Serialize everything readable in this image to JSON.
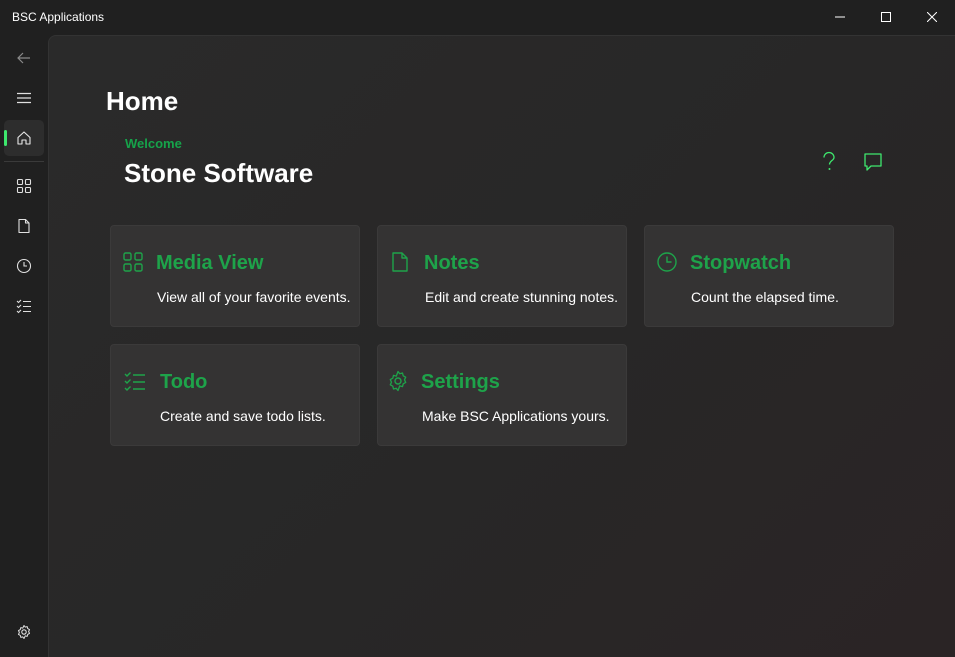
{
  "window": {
    "title": "BSC Applications",
    "controls": [
      "minimize",
      "maximize",
      "close"
    ]
  },
  "nav": {
    "items": [
      {
        "icon": "back-arrow-icon"
      },
      {
        "icon": "hamburger-menu-icon"
      },
      {
        "icon": "home-icon",
        "selected": true
      },
      {
        "icon": "grid-icon"
      },
      {
        "icon": "document-icon"
      },
      {
        "icon": "clock-icon"
      },
      {
        "icon": "checklist-icon"
      },
      {
        "icon": "settings-gear-icon"
      }
    ]
  },
  "page": {
    "title": "Home",
    "welcome": "Welcome",
    "company": "Stone Software"
  },
  "header_actions": [
    {
      "icon": "question-mark-icon"
    },
    {
      "icon": "feedback-chat-icon"
    }
  ],
  "cards": [
    {
      "title": "Media View",
      "description": "View all of your favorite events.",
      "icon": "grid-icon"
    },
    {
      "title": "Notes",
      "description": "Edit and create stunning notes.",
      "icon": "document-icon"
    },
    {
      "title": "Stopwatch",
      "description": "Count the elapsed time.",
      "icon": "clock-icon"
    },
    {
      "title": "Todo",
      "description": "Create and save todo lists.",
      "icon": "checklist-icon"
    },
    {
      "title": "Settings",
      "description": "Make BSC Applications yours.",
      "icon": "settings-gear-icon"
    }
  ],
  "colors": {
    "accent": "#1ea34a",
    "nav_indicator": "#3ee86e",
    "card_bg": "#343333",
    "window_bg": "#202020"
  }
}
